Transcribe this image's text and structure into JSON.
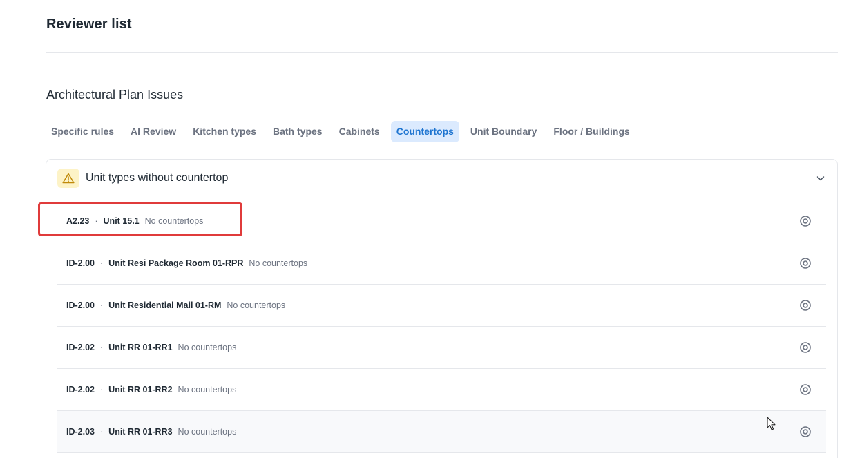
{
  "header": {
    "title": "Reviewer list"
  },
  "section": {
    "title": "Architectural Plan Issues"
  },
  "tabs": [
    {
      "label": "Specific rules",
      "active": false
    },
    {
      "label": "AI Review",
      "active": false
    },
    {
      "label": "Kitchen types",
      "active": false
    },
    {
      "label": "Bath types",
      "active": false
    },
    {
      "label": "Cabinets",
      "active": false
    },
    {
      "label": "Countertops",
      "active": true
    },
    {
      "label": "Unit Boundary",
      "active": false
    },
    {
      "label": "Floor / Buildings",
      "active": false
    }
  ],
  "panel": {
    "title": "Unit types without countertop",
    "icon": "warning-icon",
    "toggle_icon": "chevron-down-icon"
  },
  "rows": [
    {
      "code": "A2.23",
      "separator": "·",
      "unit": "Unit 15.1",
      "note": "No countertops",
      "highlighted": true
    },
    {
      "code": "ID-2.00",
      "separator": "·",
      "unit": "Unit Resi Package Room 01-RPR",
      "note": "No countertops"
    },
    {
      "code": "ID-2.00",
      "separator": "·",
      "unit": "Unit Residential Mail 01-RM",
      "note": "No countertops"
    },
    {
      "code": "ID-2.02",
      "separator": "·",
      "unit": "Unit RR 01-RR1",
      "note": "No countertops"
    },
    {
      "code": "ID-2.02",
      "separator": "·",
      "unit": "Unit RR 01-RR2",
      "note": "No countertops"
    },
    {
      "code": "ID-2.03",
      "separator": "·",
      "unit": "Unit RR 01-RR3",
      "note": "No countertops",
      "hovered": true
    }
  ],
  "colors": {
    "accent": "#1d74d0",
    "active_tab_bg": "#dbeafe",
    "warning_bg": "#fdf3c7",
    "warning_icon": "#c08a0a",
    "highlight": "#e03b3b"
  }
}
